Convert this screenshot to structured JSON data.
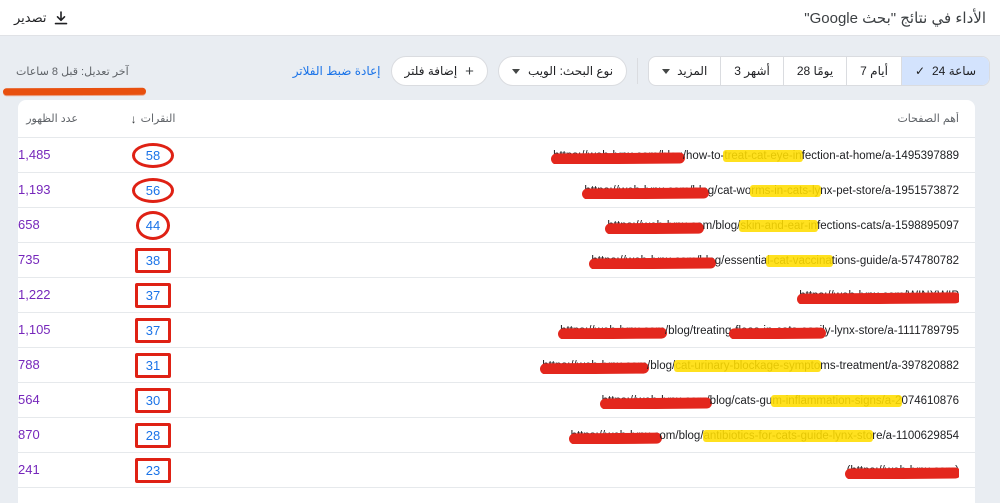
{
  "header": {
    "title": "الأداء في نتائج \"بحث Google\"",
    "export_label": "تصدير"
  },
  "toolbar": {
    "date_tabs": [
      {
        "label": "24 ساعة",
        "selected": true,
        "check_icon": "✓"
      },
      {
        "label": "7 أيام",
        "selected": false
      },
      {
        "label": "28 يومًا",
        "selected": false
      },
      {
        "label": "3 أشهر",
        "selected": false
      },
      {
        "label": "المزيد",
        "selected": false,
        "caret": true
      }
    ],
    "search_type_label": "نوع البحث: الويب",
    "add_filter_label": "إضافة فلتر",
    "reset_filters_label": "إعادة ضبط الفلاتر",
    "last_updated": "آخر تعديل: قبل 8 ساعات"
  },
  "annotations": {
    "marker_underline_color": "#e8500f",
    "redaction_red": "#e3271d",
    "redaction_yellow": "#ffdd00",
    "badge_red": "#df2114"
  },
  "table": {
    "columns": {
      "pages": "أهم الصفحات",
      "clicks": "النقرات",
      "clicks_sort_icon": "↓",
      "impressions": "عدد الظهور"
    },
    "rows": [
      {
        "clicks": "58",
        "impressions": "1,485",
        "badge_shape": "ellipse",
        "url_segments": [
          {
            "t": "red",
            "x": "https://web-lynx.com/blog"
          },
          {
            "t": "plain",
            "x": "/how-to-"
          },
          {
            "t": "yellow",
            "x": "treat-cat-eye-in"
          },
          {
            "t": "plain",
            "x": "fection-at-home/a-1495397889"
          }
        ]
      },
      {
        "clicks": "56",
        "impressions": "1,193",
        "badge_shape": "ellipse",
        "url_segments": [
          {
            "t": "red",
            "x": "https://web-lynx.com/blo"
          },
          {
            "t": "plain",
            "x": "g/cat-wo"
          },
          {
            "t": "yellow",
            "x": "rms-in-cats-ly"
          },
          {
            "t": "plain",
            "x": "nx-pet-store/a-1951573872"
          }
        ]
      },
      {
        "clicks": "44",
        "impressions": "658",
        "badge_shape": "circle",
        "url_segments": [
          {
            "t": "red",
            "x": "https://web-lynx.co"
          },
          {
            "t": "plain",
            "x": "m/blog/"
          },
          {
            "t": "yellow",
            "x": "skin-and-ear-in"
          },
          {
            "t": "plain",
            "x": "fections-cats/a-1598895097"
          }
        ]
      },
      {
        "clicks": "38",
        "impressions": "735",
        "badge_shape": "square",
        "url_segments": [
          {
            "t": "red",
            "x": "https://web-lynx.com/blo"
          },
          {
            "t": "plain",
            "x": "g/essentia"
          },
          {
            "t": "yellow",
            "x": "l-cat-vaccina"
          },
          {
            "t": "plain",
            "x": "tions-guide/a-574780782"
          }
        ]
      },
      {
        "clicks": "37",
        "impressions": "1,222",
        "badge_shape": "square",
        "url_segments": [
          {
            "t": "red",
            "x": "https://web-lynx.com/WINXWIP"
          }
        ]
      },
      {
        "clicks": "37",
        "impressions": "1,105",
        "badge_shape": "square",
        "url_segments": [
          {
            "t": "red",
            "x": "https://web-lynx.com"
          },
          {
            "t": "plain",
            "x": "/blog/treating"
          },
          {
            "t": "red",
            "x": "-fleas-in-cats-easil"
          },
          {
            "t": "plain",
            "x": "y-lynx-store/a-1111789795"
          }
        ]
      },
      {
        "clicks": "31",
        "impressions": "788",
        "badge_shape": "square",
        "url_segments": [
          {
            "t": "red",
            "x": "https://web-lynx.com"
          },
          {
            "t": "plain",
            "x": "/blog/"
          },
          {
            "t": "yellow",
            "x": "cat-urinary-blockage-sympto"
          },
          {
            "t": "plain",
            "x": "ms-treatment/a-397820882"
          }
        ]
      },
      {
        "clicks": "30",
        "impressions": "564",
        "badge_shape": "square",
        "url_segments": [
          {
            "t": "red",
            "x": "https://web-lynx.com/"
          },
          {
            "t": "plain",
            "x": "blog/cats-gu"
          },
          {
            "t": "yellow",
            "x": "m-inflammation-signs/a-2"
          },
          {
            "t": "plain",
            "x": "074610876"
          }
        ]
      },
      {
        "clicks": "28",
        "impressions": "870",
        "badge_shape": "square",
        "url_segments": [
          {
            "t": "red",
            "x": "https://web-lynx.c"
          },
          {
            "t": "plain",
            "x": "om/blog/"
          },
          {
            "t": "yellow",
            "x": "antibiotics-for-cats-guide-lynx-sto"
          },
          {
            "t": "plain",
            "x": "re/a-1100629854"
          }
        ]
      },
      {
        "clicks": "23",
        "impressions": "241",
        "badge_shape": "square",
        "url_segments": [
          {
            "t": "red",
            "x": "(https://web-lynx.com)"
          }
        ]
      }
    ]
  }
}
